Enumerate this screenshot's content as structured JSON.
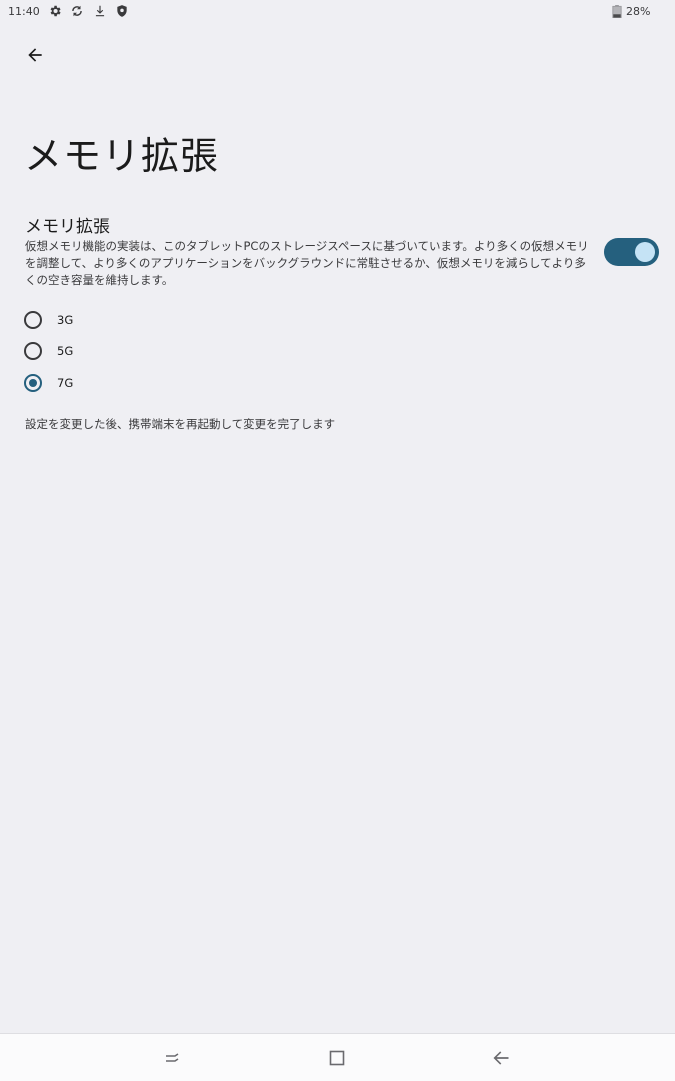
{
  "status_bar": {
    "time": "11:40",
    "icons": [
      "gear-icon",
      "sync-icon",
      "download-icon",
      "shield-icon"
    ],
    "battery_text": "28%"
  },
  "page": {
    "title": "メモリ拡張"
  },
  "setting": {
    "title": "メモリ拡張",
    "description": "仮想メモリ機能の実装は、このタブレットPCのストレージスペースに基づいています。より多くの仮想メモリを調整して、より多くのアプリケーションをバックグラウンドに常駐させるか、仮想メモリを減らしてより多くの空き容量を維持します。",
    "enabled": true
  },
  "options": [
    {
      "label": "3G",
      "selected": false
    },
    {
      "label": "5G",
      "selected": false
    },
    {
      "label": "7G",
      "selected": true
    }
  ],
  "footer_note": "設定を変更した後、携帯端末を再起動して変更を完了します",
  "colors": {
    "background": "#efeff3",
    "accent": "#25607e",
    "toggle_knob": "#c5e3f5"
  },
  "nav_bar": {
    "buttons": [
      "recents-icon",
      "home-icon",
      "back-icon"
    ]
  }
}
